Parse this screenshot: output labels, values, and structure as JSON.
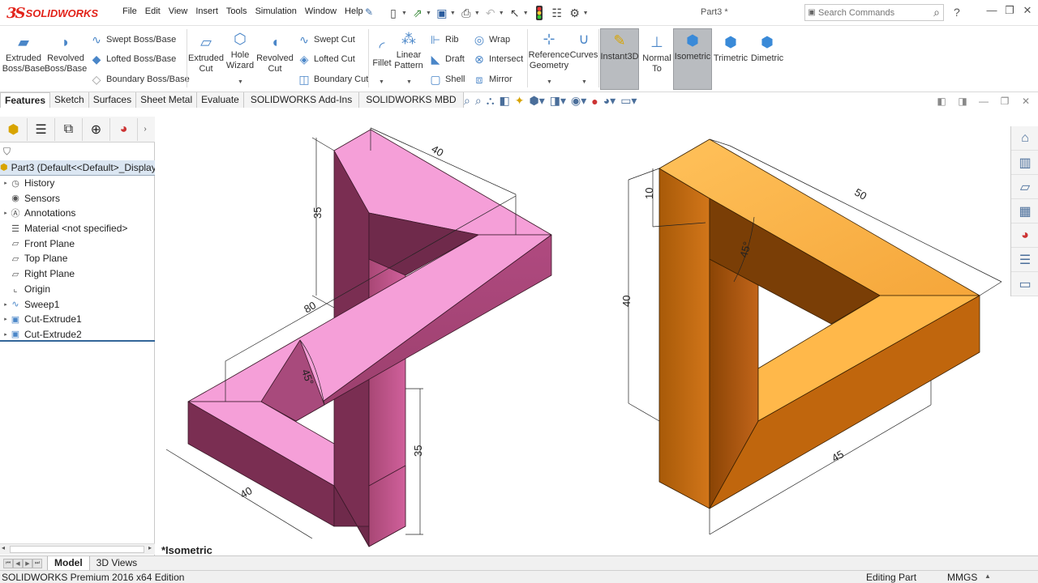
{
  "app": {
    "brand_mark": "3S",
    "brand_name": "SOLIDWORKS",
    "document_title": "Part3 *"
  },
  "menu": [
    "File",
    "Edit",
    "View",
    "Insert",
    "Tools",
    "Simulation",
    "Window",
    "Help"
  ],
  "search": {
    "placeholder": "Search Commands"
  },
  "help_label": "?",
  "ribbon": {
    "extruded_boss": [
      "Extruded",
      "Boss/Base"
    ],
    "revolved_boss": [
      "Revolved",
      "Boss/Base"
    ],
    "swept_boss": "Swept Boss/Base",
    "lofted_boss": "Lofted Boss/Base",
    "boundary_boss": "Boundary Boss/Base",
    "extruded_cut": [
      "Extruded",
      "Cut"
    ],
    "hole_wizard": [
      "Hole",
      "Wizard"
    ],
    "revolved_cut": [
      "Revolved",
      "Cut"
    ],
    "swept_cut": "Swept Cut",
    "lofted_cut": "Lofted Cut",
    "boundary_cut": "Boundary Cut",
    "fillet": "Fillet",
    "linear_pattern": [
      "Linear",
      "Pattern"
    ],
    "rib": "Rib",
    "draft": "Draft",
    "shell": "Shell",
    "wrap": "Wrap",
    "intersect": "Intersect",
    "mirror": "Mirror",
    "reference_geometry": [
      "Reference",
      "Geometry"
    ],
    "curves": "Curves",
    "instant3d": "Instant3D",
    "normal_to": [
      "Normal",
      "To"
    ],
    "isometric": "Isometric",
    "trimetric": "Trimetric",
    "dimetric": "Dimetric"
  },
  "tabs": [
    "Features",
    "Sketch",
    "Surfaces",
    "Sheet Metal",
    "Evaluate",
    "SOLIDWORKS Add-Ins",
    "SOLIDWORKS MBD"
  ],
  "tree": {
    "root": "Part3  (Default<<Default>_Display",
    "items": [
      "History",
      "Sensors",
      "Annotations",
      "Material <not specified>",
      "Front Plane",
      "Top Plane",
      "Right Plane",
      "Origin",
      "Sweep1",
      "Cut-Extrude1",
      "Cut-Extrude2"
    ]
  },
  "viewport": {
    "view_name": "*Isometric",
    "left_model": {
      "color": "#f59fd8",
      "dims": {
        "d40_top": "40",
        "d35_left": "35",
        "d80": "80",
        "d45": "45°",
        "d35_right": "35",
        "d40_bottom": "40"
      }
    },
    "right_model": {
      "color": "#f7a43a",
      "dims": {
        "d10": "10",
        "d50": "50",
        "d45ang": "45°",
        "d40": "40",
        "d45": "45"
      }
    }
  },
  "bottom_tabs": [
    "Model",
    "3D Views"
  ],
  "status": {
    "edition": "SOLIDWORKS Premium 2016 x64 Edition",
    "mode": "Editing Part",
    "units": "MMGS"
  },
  "colors": {
    "accent": "#336699",
    "brand": "#e2231a",
    "active_toggle": "#b9bcc0"
  }
}
